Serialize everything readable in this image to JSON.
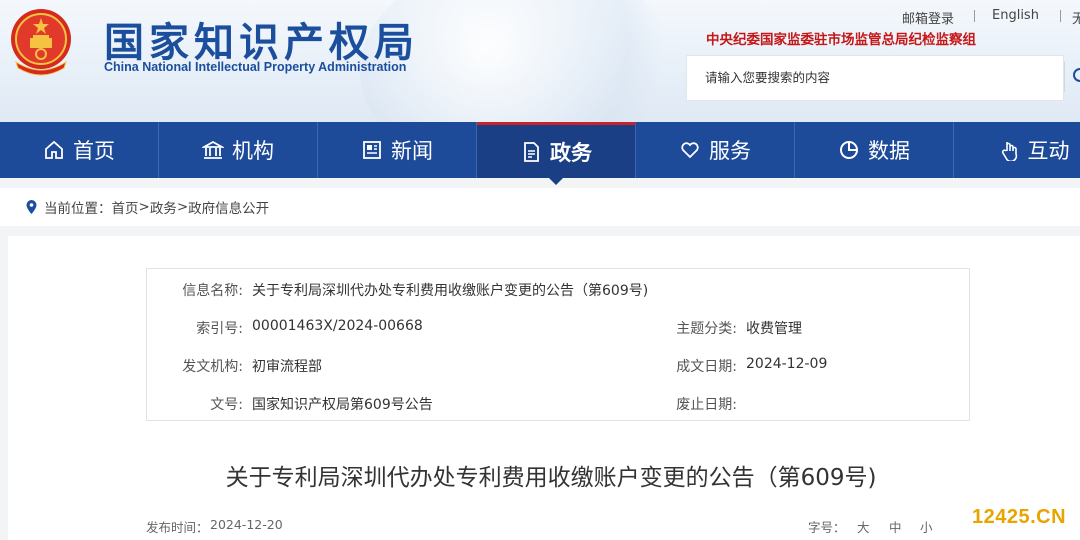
{
  "header": {
    "site_title": "国家知识产权局",
    "site_subtitle": "China National Intellectual Property Administration",
    "top_links": {
      "mail": "邮箱登录",
      "english": "English",
      "more": "无"
    },
    "inspection_group": "中央纪委国家监委驻市场监管总局纪检监察组",
    "search": {
      "placeholder": "请输入您要搜索的内容"
    }
  },
  "nav": {
    "items": [
      {
        "label": "首页",
        "icon": "home-icon"
      },
      {
        "label": "机构",
        "icon": "building-icon"
      },
      {
        "label": "新闻",
        "icon": "news-icon"
      },
      {
        "label": "政务",
        "icon": "document-icon",
        "active": true
      },
      {
        "label": "服务",
        "icon": "heart-hand-icon"
      },
      {
        "label": "数据",
        "icon": "pie-chart-icon"
      },
      {
        "label": "互动",
        "icon": "hand-pointer-icon"
      }
    ]
  },
  "breadcrumb": {
    "prefix": "当前位置：",
    "items": [
      "首页",
      "政务",
      "政府信息公开"
    ],
    "separator": ">"
  },
  "info": {
    "name_label": "信息名称:",
    "name_value": "关于专利局深圳代办处专利费用收缴账户变更的公告（第609号)",
    "index_label": "索引号:",
    "index_value": "00001463X/2024-00668",
    "category_label": "主题分类:",
    "category_value": "收费管理",
    "issuer_label": "发文机构:",
    "issuer_value": "初审流程部",
    "date_label": "成文日期:",
    "date_value": "2024-12-09",
    "docno_label": "文号:",
    "docno_value": "国家知识产权局第609号公告",
    "expiry_label": "废止日期:",
    "expiry_value": ""
  },
  "article": {
    "title": "关于专利局深圳代办处专利费用收缴账户变更的公告（第609号)",
    "publish_label": "发布时间：",
    "publish_date": "2024-12-20",
    "font_size_label": "字号：",
    "font_sizes": [
      "大",
      "中",
      "小"
    ]
  },
  "watermark": "12425.CN",
  "colors": {
    "brand_blue": "#1b4e9c",
    "nav_blue": "#1e4a9a",
    "active_red": "#c8232c",
    "inspection_red": "#c41818",
    "watermark_orange": "#e8a500"
  }
}
